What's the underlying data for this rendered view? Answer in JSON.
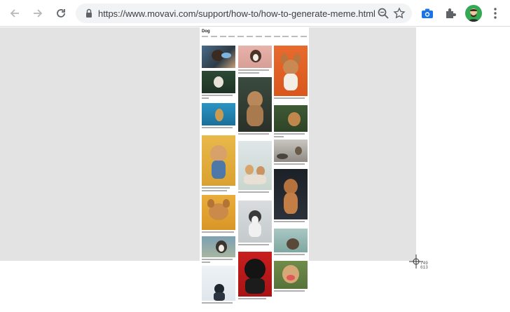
{
  "browser": {
    "url": "https://www.movavi.com/support/how-to/how-to-generate-meme.html"
  },
  "page": {
    "section_title": "Dog"
  },
  "cursor": {
    "x_readout": "749",
    "y_readout": "613"
  },
  "colors": {
    "dim_overlay": "#e3e3e3",
    "avatar_bg": "#34a853",
    "camera_icon": "#1a73e8"
  }
}
